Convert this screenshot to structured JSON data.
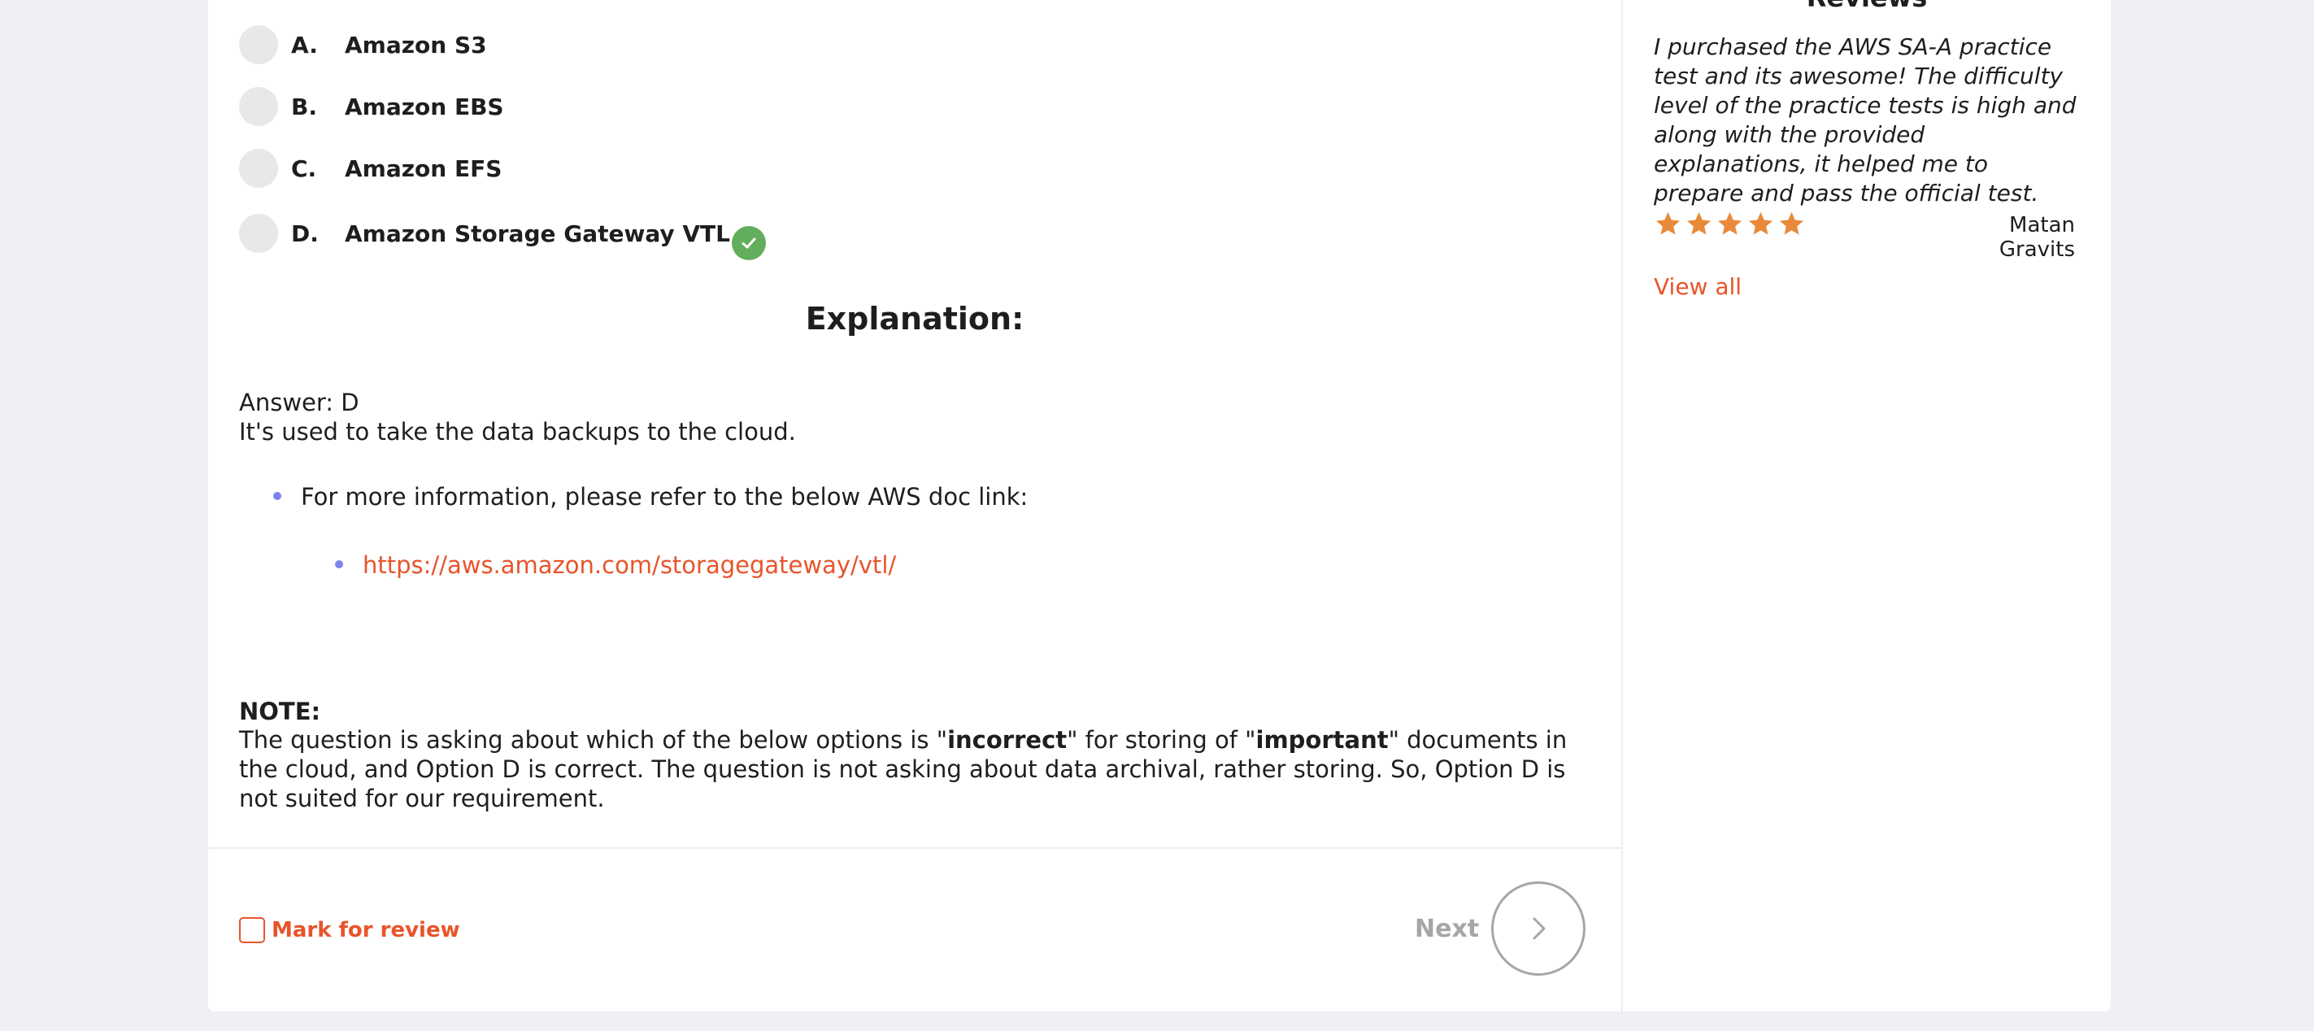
{
  "question": {
    "options": [
      {
        "letter": "A.",
        "text": "Amazon S3"
      },
      {
        "letter": "B.",
        "text": "Amazon EBS"
      },
      {
        "letter": "C.",
        "text": "Amazon EFS"
      },
      {
        "letter": "D.",
        "text": "Amazon Storage Gateway VTL",
        "correct": true
      }
    ]
  },
  "explanation": {
    "title": "Explanation:",
    "answer": "Answer: D",
    "summary": "It's used to take the data backups to the cloud.",
    "bullet_text": "For more information, please refer to the below AWS doc link:",
    "link": "https://aws.amazon.com/storagegateway/vtl/",
    "note_label": "NOTE:",
    "note_part1": " The question is asking about which of the below options is \"",
    "note_bold1": "incorrect",
    "note_part2": "\" for storing of \"",
    "note_bold2": "important",
    "note_part3": "\" documents in the cloud, and Option D is correct.  The question is not asking about data archival, rather storing.  So, Option D is not suited for our requirement."
  },
  "footer": {
    "mark_label": "Mark for review",
    "next_label": "Next"
  },
  "sidebar": {
    "title": "Reviews",
    "review_text": "I purchased the AWS SA-A practice test and its awesome! The difficulty level of the practice tests is high and along with the provided explanations, it helped me to prepare and pass the official test.",
    "rating": 5,
    "reviewer": "Matan Gravits",
    "view_all": "View all"
  },
  "colors": {
    "accent": "#e8542a",
    "correct": "#63ae5c",
    "star": "#e88a3a",
    "bullet": "#7b86e8"
  },
  "icons": [
    "check-icon",
    "star-icon",
    "chevron-right-icon",
    "checkbox-icon"
  ]
}
